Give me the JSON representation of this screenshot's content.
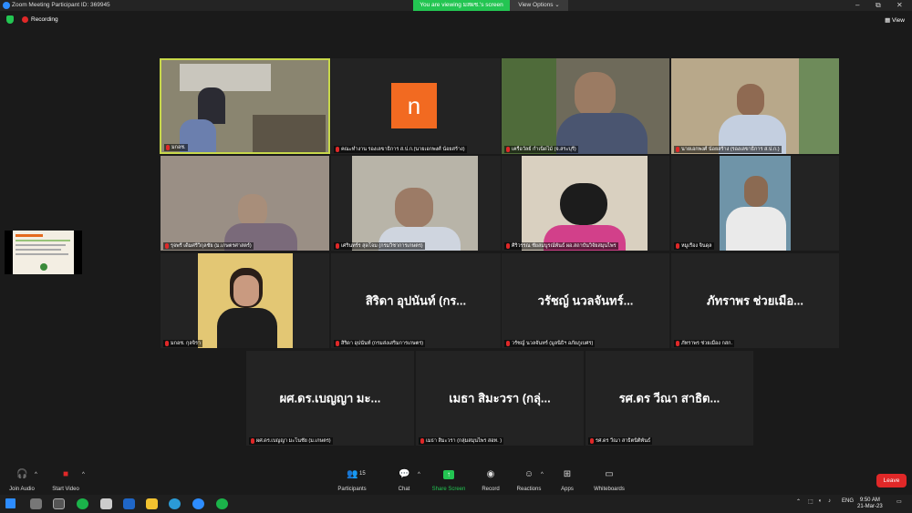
{
  "window": {
    "title": "Zoom Meeting Participant ID: 369945",
    "sharing_banner": "You are viewing มสผช.'s screen",
    "view_options": "View Options",
    "controls": [
      "–",
      "⧉",
      "✕"
    ]
  },
  "top": {
    "recording": "Recording",
    "view": "View"
  },
  "tiles": [
    {
      "name": "มกอช.",
      "type": "video"
    },
    {
      "name": "คณะทำงาน รองเลขาธิการ ส.ป.ก.(นายเอกพงศ์ น้อยสร้าง)",
      "avatar_letter": "n",
      "type": "avatar"
    },
    {
      "name": "เครือวัลย์ กำเนิดไม้ (จ.สระบุรี)",
      "type": "video"
    },
    {
      "name": "นายเอกพงศ์ น้อยสร้าง (รองเลขาธิการ ส.ป.ก.)",
      "type": "video"
    },
    {
      "name": "รุจพรี เดิมศรีวิกุลชัย (ม.เกษตรศาสตร์)",
      "type": "video"
    },
    {
      "name": "เศรินทร์ร สุดโจม (กรมวิชาการเกษตร)",
      "type": "video"
    },
    {
      "name": "ศิริวรรณ ชัยสมบูรณ์พันธ์ ผอ.สถาบันวิจัยสมุนไพร",
      "type": "video"
    },
    {
      "name": "หมูเรือง จินดุล",
      "type": "video"
    },
    {
      "name": "มกอช. กุลจิรา",
      "type": "video"
    },
    {
      "name": "สิริดา อุปนันท์ (กรมส่งเสริมการเกษตร)",
      "display": "สิริดา อุปนันท์ (กร...",
      "type": "text"
    },
    {
      "name": "วรัชญ์ นวลจันทร์ (มูลนิธิฯ อภัยภูเบศร)",
      "display": "วรัชญ์ นวลจันทร์...",
      "type": "text"
    },
    {
      "name": "ภัทราพร ช่วยเมือง กสก.",
      "display": "ภัทราพร ช่วยเมือ...",
      "type": "text"
    },
    {
      "name": "ผศ.ดร.เบญญา มะโนชัย (ม.เกษตร)",
      "display": "ผศ.ดร.เบญญา มะ...",
      "type": "text"
    },
    {
      "name": "เมธา สิมะวรา (กลุ่มสมุนไพร สอท. )",
      "display": "เมธา สิมะวรา (กลุ่...",
      "type": "text"
    },
    {
      "name": "รศ.ดร วีณา สาธิตนิติพันธ์",
      "display": "รศ.ดร วีณา สาธิต...",
      "type": "text"
    }
  ],
  "toolbar": {
    "join_audio": "Join Audio",
    "start_video": "Start Video",
    "participants": "Participants",
    "participants_count": "15",
    "chat": "Chat",
    "share_screen": "Share Screen",
    "record": "Record",
    "reactions": "Reactions",
    "apps": "Apps",
    "whiteboards": "Whiteboards",
    "leave": "Leave"
  },
  "taskbar": {
    "lang": "ENG",
    "time": "9:50 AM",
    "date": "21-Mar-23"
  },
  "colors": {
    "share_green": "#23c552",
    "leave_red": "#e02828",
    "active_border": "#c8d84a",
    "avatar_orange": "#f26a21"
  }
}
